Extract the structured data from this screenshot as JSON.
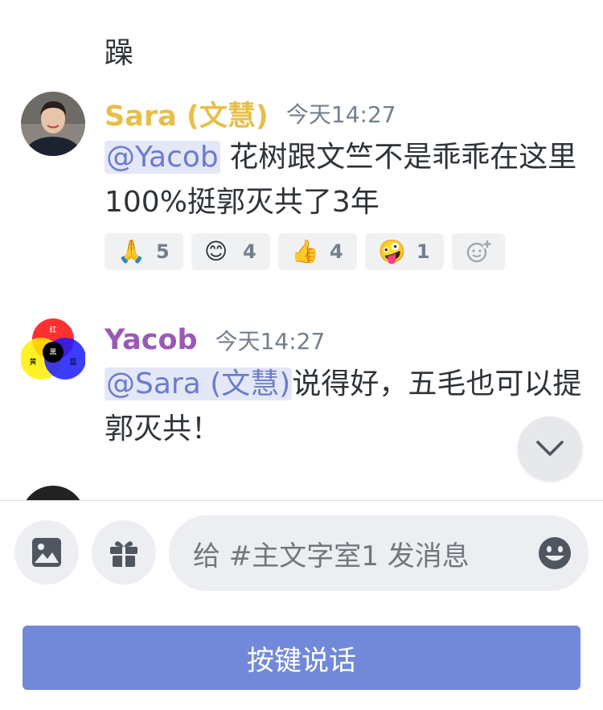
{
  "previous_message": {
    "visible_text": "躁"
  },
  "messages": [
    {
      "author": "Sara (文慧)",
      "author_color": "#e6bf4a",
      "timestamp": "今天14:27",
      "mention": "@Yacob",
      "text": " 花树跟文竺不是乖乖在这里100%挺郭灭共了3年",
      "reactions": [
        {
          "emoji": "🙏",
          "icon": "folded-hands-icon",
          "count": "5"
        },
        {
          "emoji": "😊",
          "icon": "smiling-face-icon",
          "count": "4"
        },
        {
          "emoji": "👍",
          "icon": "thumbs-up-icon",
          "count": "4"
        },
        {
          "emoji": "🤪",
          "icon": "zany-face-icon",
          "count": "1"
        }
      ],
      "add_reaction_icon": "add-reaction-icon"
    },
    {
      "author": "Yacob",
      "author_color": "#9b59b6",
      "timestamp": "今天14:27",
      "mention": "@Sara (文慧)",
      "text": "说得好，五毛也可以提郭灭共！",
      "avatar_labels": {
        "top": "红",
        "left": "黄",
        "right": "蓝",
        "center": "黑"
      }
    }
  ],
  "scroll_down_icon": "chevron-down-icon",
  "composer": {
    "image_icon": "image-icon",
    "gift_icon": "gift-icon",
    "placeholder": "给 #主文字室1 发消息",
    "emoji_icon": "emoji-icon",
    "push_to_talk_label": "按键说话",
    "accent": "#7289da"
  }
}
